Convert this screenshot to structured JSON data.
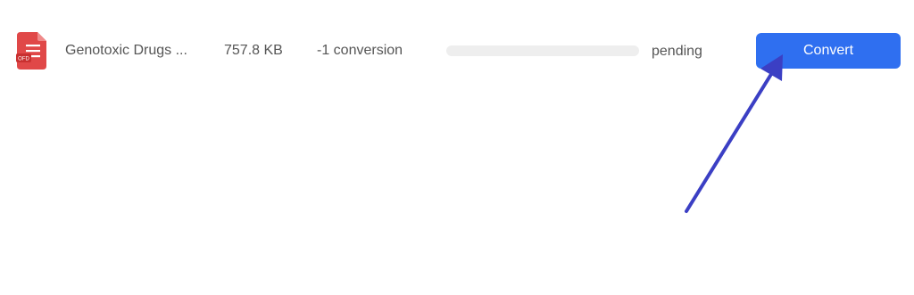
{
  "file": {
    "icon": "pdf-file-icon",
    "icon_badge": "OFD",
    "name": "Genotoxic Drugs ...",
    "size": "757.8 KB",
    "conversions": "-1 conversion",
    "progress_fraction": 0,
    "status": "pending"
  },
  "actions": {
    "convert_label": "Convert"
  },
  "colors": {
    "accent": "#2f6ff0",
    "icon_red": "#e04848",
    "annotation_arrow": "#3b3fc4"
  }
}
